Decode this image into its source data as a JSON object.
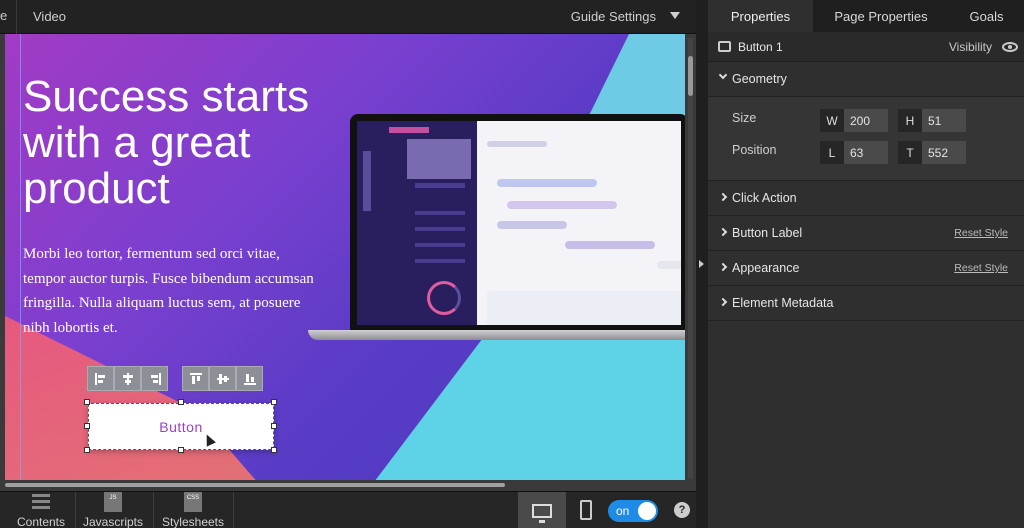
{
  "topbar": {
    "edge_label": "e",
    "title": "Video",
    "guide_settings": "Guide Settings"
  },
  "hero": {
    "title": "Success starts with a great product",
    "body": "Morbi leo tortor, fermentum sed orci vitae, tempor auctor turpis. Fusce bibendum accumsan fringilla. Nulla aliquam luctus sem, at posuere nibh lobortis et."
  },
  "selected_button": {
    "label": "Button"
  },
  "alignment_tools": [
    "align-left",
    "align-center",
    "align-right",
    "align-top",
    "align-middle",
    "align-bottom"
  ],
  "bottombar": {
    "contents": "Contents",
    "javascripts": "Javascripts",
    "javascripts_icon": "JS",
    "stylesheets": "Stylesheets",
    "stylesheets_icon": "CSS",
    "toggle": "on",
    "help": "?"
  },
  "panel": {
    "tabs": [
      "Properties",
      "Page Properties",
      "Goals"
    ],
    "element_name": "Button 1",
    "visibility": "Visibility",
    "geometry": {
      "title": "Geometry",
      "size_label": "Size",
      "position_label": "Position",
      "w_key": "W",
      "w_val": "200",
      "h_key": "H",
      "h_val": "51",
      "l_key": "L",
      "l_val": "63",
      "t_key": "T",
      "t_val": "552"
    },
    "sections": {
      "click_action": "Click Action",
      "button_label": "Button Label",
      "appearance": "Appearance",
      "element_metadata": "Element Metadata",
      "reset_style": "Reset Style"
    }
  },
  "colors": {
    "accent": "#1e8ce6",
    "button_text": "#9b3fc4",
    "canvas_gradient_start": "#a23bc4",
    "canvas_gradient_end": "#4a38c0"
  }
}
